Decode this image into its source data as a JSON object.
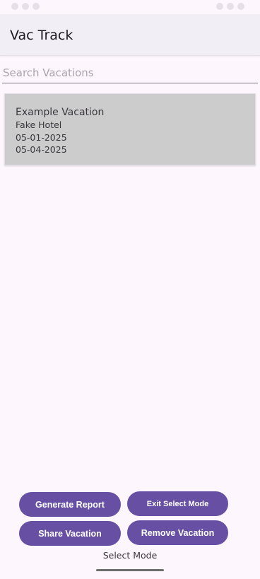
{
  "app": {
    "title": "Vac Track"
  },
  "search": {
    "placeholder": "Search Vacations",
    "value": ""
  },
  "vacations": [
    {
      "title": "Example Vacation",
      "hotel": "Fake Hotel",
      "start_date": "05-01-2025",
      "end_date": "05-04-2025"
    }
  ],
  "buttons": {
    "generate_report": "Generate Report",
    "exit_select_mode": "Exit Select Mode",
    "share_vacation": "Share Vacation",
    "remove_vacation": "Remove Vacation"
  },
  "mode": {
    "label": "Select Mode"
  },
  "colors": {
    "primary": "#6750a4",
    "background": "#fdf6fd",
    "app_bar": "#f2eef5",
    "card": "#cccccc"
  }
}
